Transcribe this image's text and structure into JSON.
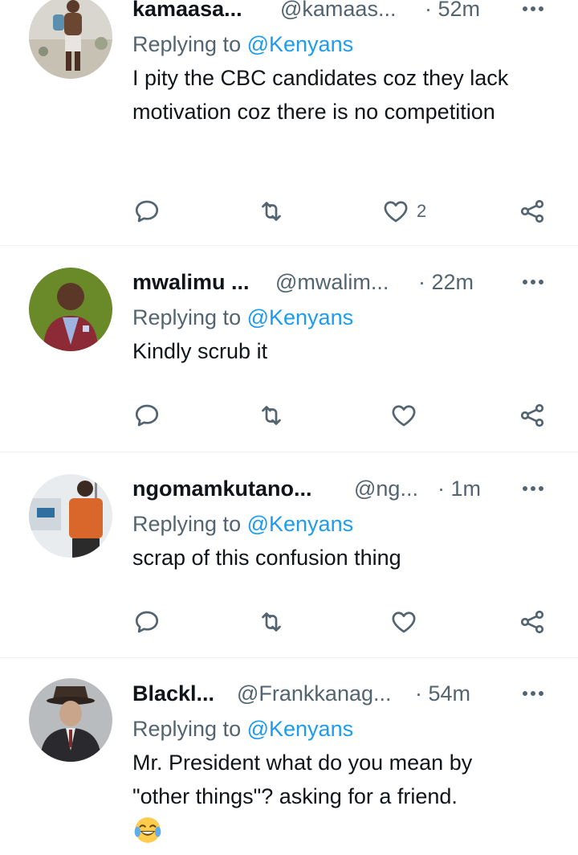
{
  "tweets": [
    {
      "name": "kamaasa...",
      "handle": "@kamaas...",
      "time": "· 52m",
      "replying_prefix": "Replying to",
      "replying_to": "@Kenyans",
      "text": "I pity the CBC candidates coz they lack motivation coz there is no competition",
      "like_count": "2",
      "avatar": "man-standing-outdoors-photo"
    },
    {
      "name": "mwalimu ...",
      "handle": "@mwalim...",
      "time": "· 22m",
      "replying_prefix": "Replying to",
      "replying_to": "@Kenyans",
      "text": "Kindly scrub it",
      "like_count": "",
      "avatar": "man-in-suit-green-background-photo"
    },
    {
      "name": "ngomamkutano...",
      "handle": "@ng...",
      "time": "· 1m",
      "replying_prefix": "Replying to",
      "replying_to": "@Kenyans",
      "text": "scrap of this confusion thing",
      "like_count": "",
      "avatar": "person-in-orange-vest-photo"
    },
    {
      "name": "Blackl...",
      "handle": "@Frankkanag...",
      "time": "· 54m",
      "replying_prefix": "Replying to",
      "replying_to": "@Kenyans",
      "text": "Mr. President what do you mean by \"other things\"? asking for a friend.",
      "emoji": "face-with-tears-of-joy",
      "avatar": "man-in-fedora-hat-photo"
    }
  ],
  "colors": {
    "text": "#0f1419",
    "secondary": "#536471",
    "accent": "#1d9bf0",
    "separator": "#eff3f4"
  },
  "icons": {
    "reply": "reply-bubble-icon",
    "retweet": "retweet-icon",
    "like": "heart-icon",
    "share": "share-icon",
    "more": "more-dots-icon"
  }
}
